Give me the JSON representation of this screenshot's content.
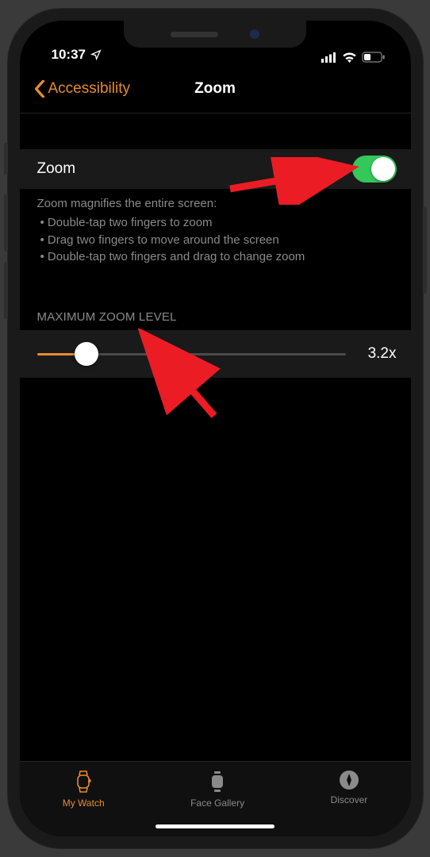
{
  "statusbar": {
    "time": "10:37"
  },
  "nav": {
    "back_label": "Accessibility",
    "title": "Zoom"
  },
  "zoom_row": {
    "label": "Zoom",
    "enabled": true
  },
  "help": {
    "intro": "Zoom magnifies the entire screen:",
    "items": [
      "Double-tap two fingers to zoom",
      "Drag two fingers to move around the screen",
      "Double-tap two fingers and drag to change zoom"
    ]
  },
  "slider": {
    "header": "MAXIMUM ZOOM LEVEL",
    "value_label": "3.2x",
    "percent": 16
  },
  "tabs": {
    "watch": "My Watch",
    "gallery": "Face Gallery",
    "discover": "Discover"
  }
}
